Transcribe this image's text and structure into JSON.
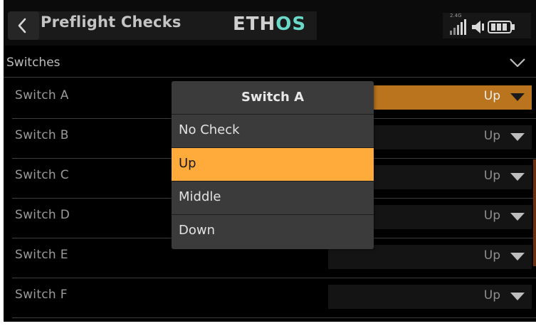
{
  "header": {
    "title": "Preflight Checks",
    "logo_part1": "ETH",
    "logo_part2": "OS",
    "rf_label": "2.4G"
  },
  "section": {
    "label": "Switches"
  },
  "rows": [
    {
      "label": "Switch A",
      "value": "Up"
    },
    {
      "label": "Switch B",
      "value": "Up"
    },
    {
      "label": "Switch C",
      "value": "Up"
    },
    {
      "label": "Switch D",
      "value": "Up"
    },
    {
      "label": "Switch E",
      "value": "Up"
    },
    {
      "label": "Switch F",
      "value": "Up"
    }
  ],
  "popup": {
    "title": "Switch A",
    "options": [
      "No Check",
      "Up",
      "Middle",
      "Down"
    ],
    "selected": "Up"
  },
  "colors": {
    "accent": "#ffab3c",
    "active_field": "#b9741d",
    "logo_os": "#6ad9c9"
  }
}
